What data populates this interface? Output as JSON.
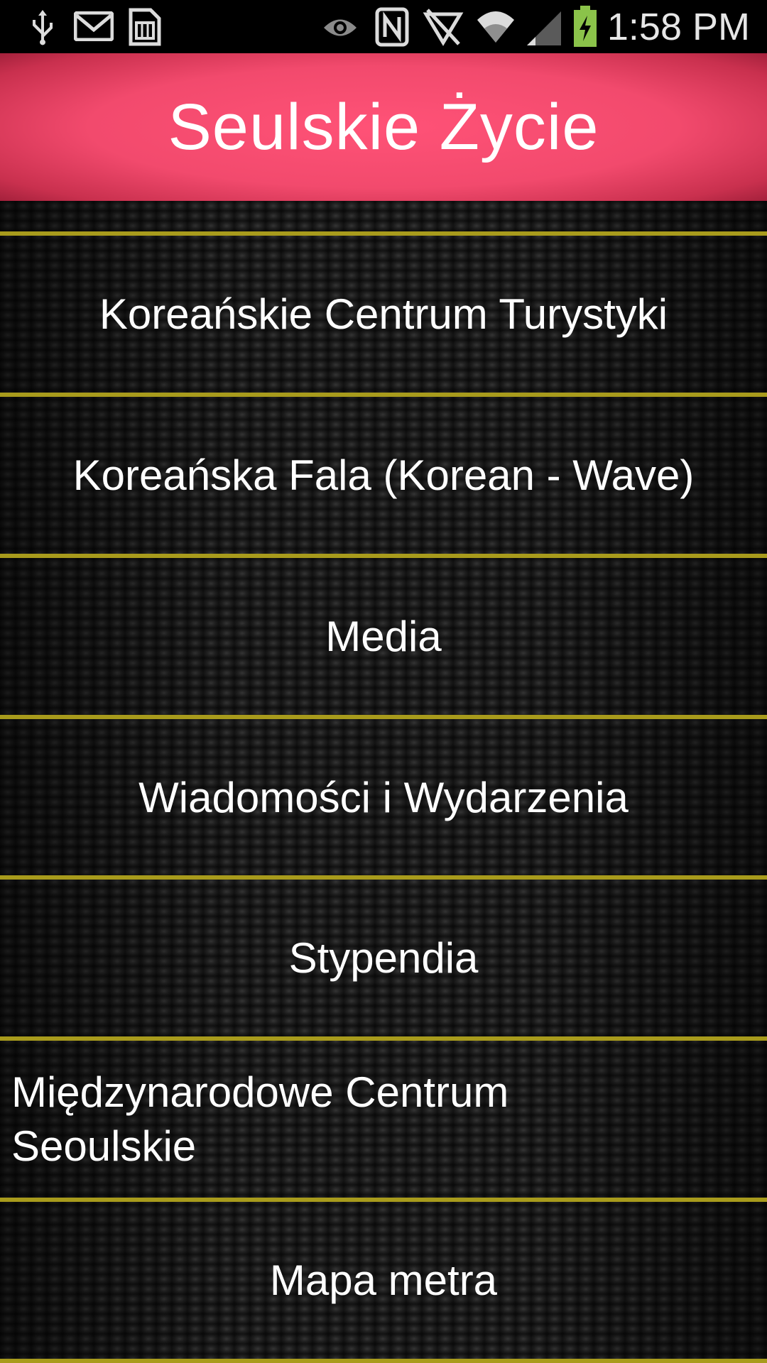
{
  "status_bar": {
    "time": "1:58 PM",
    "left_icons": [
      "usb-icon",
      "gmail-icon",
      "sim-card-icon"
    ],
    "right_icons": [
      "eye-icon",
      "nfc-icon",
      "no-signal-icon",
      "wifi-icon",
      "cell-signal-icon",
      "battery-charging-icon"
    ]
  },
  "header": {
    "title": "Seulskie Życie"
  },
  "colors": {
    "header_accent": "#ff5277",
    "divider": "#a89b1c",
    "text": "#ffffff"
  },
  "menu": {
    "items": [
      {
        "label": "Koreańskie Centrum Turystyki"
      },
      {
        "label": "Koreańska Fala (Korean - Wave)"
      },
      {
        "label": "Media"
      },
      {
        "label": "Wiadomości i Wydarzenia"
      },
      {
        "label": "Stypendia"
      },
      {
        "label": "Międzynarodowe Centrum Seoulskie"
      },
      {
        "label": "Mapa metra"
      }
    ]
  }
}
